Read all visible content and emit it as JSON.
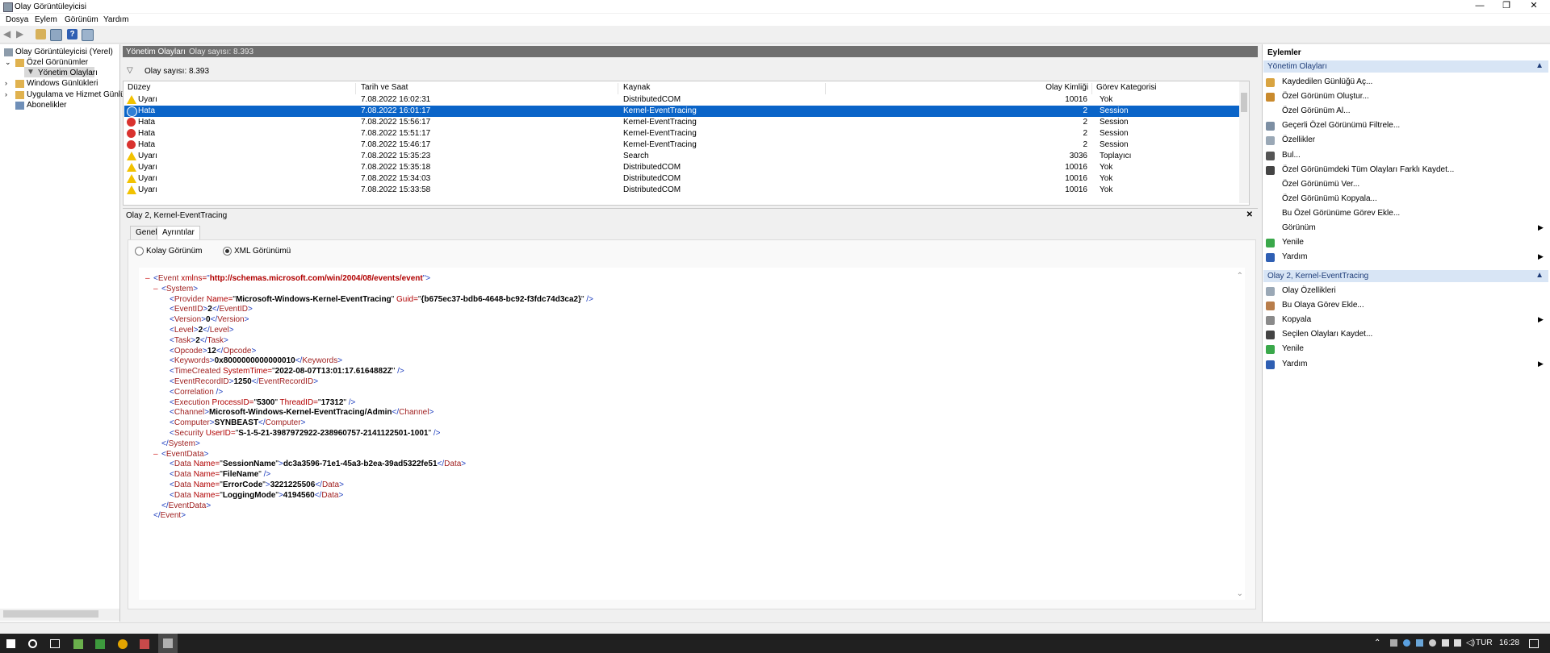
{
  "window": {
    "title": "Olay Görüntüleyicisi",
    "minimize": "—",
    "maximize": "❐",
    "close": "✕"
  },
  "menu": [
    "Dosya",
    "Eylem",
    "Görünüm",
    "Yardım"
  ],
  "tree": {
    "root": "Olay Görüntüleyicisi (Yerel)",
    "custom_views": "Özel Görünümler",
    "admin_events": "Yönetim Olayları",
    "windows_logs": "Windows Günlükleri",
    "app_service_logs": "Uygulama ve Hizmet Günlük",
    "subscriptions": "Abonelikler"
  },
  "center": {
    "header_title": "Yönetim Olayları",
    "header_count": "Olay sayısı: 8.393",
    "filter_count": "Olay sayısı: 8.393",
    "columns": [
      "Düzey",
      "Tarih ve Saat",
      "Kaynak",
      "Olay Kimliği",
      "Görev Kategorisi"
    ],
    "rows": [
      {
        "level": "Uyarı",
        "icon": "warning-icon",
        "date": "7.08.2022 16:02:31",
        "source": "DistributedCOM",
        "id": "10016",
        "category": "Yok",
        "selected": false
      },
      {
        "level": "Hata",
        "icon": "info-icon",
        "date": "7.08.2022 16:01:17",
        "source": "Kernel-EventTracing",
        "id": "2",
        "category": "Session",
        "selected": true
      },
      {
        "level": "Hata",
        "icon": "error-icon",
        "date": "7.08.2022 15:56:17",
        "source": "Kernel-EventTracing",
        "id": "2",
        "category": "Session",
        "selected": false
      },
      {
        "level": "Hata",
        "icon": "error-icon",
        "date": "7.08.2022 15:51:17",
        "source": "Kernel-EventTracing",
        "id": "2",
        "category": "Session",
        "selected": false
      },
      {
        "level": "Hata",
        "icon": "error-icon",
        "date": "7.08.2022 15:46:17",
        "source": "Kernel-EventTracing",
        "id": "2",
        "category": "Session",
        "selected": false
      },
      {
        "level": "Uyarı",
        "icon": "warning-icon",
        "date": "7.08.2022 15:35:23",
        "source": "Search",
        "id": "3036",
        "category": "Toplayıcı",
        "selected": false
      },
      {
        "level": "Uyarı",
        "icon": "warning-icon",
        "date": "7.08.2022 15:35:18",
        "source": "DistributedCOM",
        "id": "10016",
        "category": "Yok",
        "selected": false
      },
      {
        "level": "Uyarı",
        "icon": "warning-icon",
        "date": "7.08.2022 15:34:03",
        "source": "DistributedCOM",
        "id": "10016",
        "category": "Yok",
        "selected": false
      },
      {
        "level": "Uyarı",
        "icon": "warning-icon",
        "date": "7.08.2022 15:33:58",
        "source": "DistributedCOM",
        "id": "10016",
        "category": "Yok",
        "selected": false
      }
    ]
  },
  "detail": {
    "title": "Olay 2, Kernel-EventTracing",
    "close": "✕",
    "tabs": [
      "Genel",
      "Ayrıntılar"
    ],
    "active_tab": "Ayrıntılar",
    "radio_friendly": "Kolay Görünüm",
    "radio_xml": "XML Görünümü",
    "xml_selected": true,
    "xml_lines": [
      {
        "indent": 0,
        "marker": "–",
        "html": "<span class='brk'>&lt;</span><span class='tag'>Event</span> <span class='attr'>xmlns=</span><span class='brk'>\"</span><span class='attr'><b>http://schemas.microsoft.com/win/2004/08/events/event</b></span><span class='brk'>\"&gt;</span>"
      },
      {
        "indent": 1,
        "marker": "–",
        "html": "<span class='brk'>&lt;</span><span class='tag'>System</span><span class='brk'>&gt;</span>"
      },
      {
        "indent": 2,
        "html": "<span class='brk'>&lt;</span><span class='tag'>Provider</span> <span class='attr'>Name=</span>\"<span class='val'>Microsoft-Windows-Kernel-EventTracing</span>\" <span class='attr'>Guid=</span>\"<span class='val'>{b675ec37-bdb6-4648-bc92-f3fdc74d3ca2}</span>\" <span class='brk'>/&gt;</span>"
      },
      {
        "indent": 2,
        "html": "<span class='brk'>&lt;</span><span class='tag'>EventID</span><span class='brk'>&gt;</span><span class='val'>2</span><span class='brk'>&lt;/</span><span class='tag'>EventID</span><span class='brk'>&gt;</span>"
      },
      {
        "indent": 2,
        "html": "<span class='brk'>&lt;</span><span class='tag'>Version</span><span class='brk'>&gt;</span><span class='val'>0</span><span class='brk'>&lt;/</span><span class='tag'>Version</span><span class='brk'>&gt;</span>"
      },
      {
        "indent": 2,
        "html": "<span class='brk'>&lt;</span><span class='tag'>Level</span><span class='brk'>&gt;</span><span class='val'>2</span><span class='brk'>&lt;/</span><span class='tag'>Level</span><span class='brk'>&gt;</span>"
      },
      {
        "indent": 2,
        "html": "<span class='brk'>&lt;</span><span class='tag'>Task</span><span class='brk'>&gt;</span><span class='val'>2</span><span class='brk'>&lt;/</span><span class='tag'>Task</span><span class='brk'>&gt;</span>"
      },
      {
        "indent": 2,
        "html": "<span class='brk'>&lt;</span><span class='tag'>Opcode</span><span class='brk'>&gt;</span><span class='val'>12</span><span class='brk'>&lt;/</span><span class='tag'>Opcode</span><span class='brk'>&gt;</span>"
      },
      {
        "indent": 2,
        "html": "<span class='brk'>&lt;</span><span class='tag'>Keywords</span><span class='brk'>&gt;</span><span class='val'>0x8000000000000010</span><span class='brk'>&lt;/</span><span class='tag'>Keywords</span><span class='brk'>&gt;</span>"
      },
      {
        "indent": 2,
        "html": "<span class='brk'>&lt;</span><span class='tag'>TimeCreated</span> <span class='attr'>SystemTime=</span>\"<span class='val'>2022-08-07T13:01:17.6164882Z</span>\" <span class='brk'>/&gt;</span>"
      },
      {
        "indent": 2,
        "html": "<span class='brk'>&lt;</span><span class='tag'>EventRecordID</span><span class='brk'>&gt;</span><span class='val'>1250</span><span class='brk'>&lt;/</span><span class='tag'>EventRecordID</span><span class='brk'>&gt;</span>"
      },
      {
        "indent": 2,
        "html": "<span class='brk'>&lt;</span><span class='tag'>Correlation</span> <span class='brk'>/&gt;</span>"
      },
      {
        "indent": 2,
        "html": "<span class='brk'>&lt;</span><span class='tag'>Execution</span> <span class='attr'>ProcessID=</span>\"<span class='val'>5300</span>\" <span class='attr'>ThreadID=</span>\"<span class='val'>17312</span>\" <span class='brk'>/&gt;</span>"
      },
      {
        "indent": 2,
        "html": "<span class='brk'>&lt;</span><span class='tag'>Channel</span><span class='brk'>&gt;</span><span class='val'>Microsoft-Windows-Kernel-EventTracing/Admin</span><span class='brk'>&lt;/</span><span class='tag'>Channel</span><span class='brk'>&gt;</span>"
      },
      {
        "indent": 2,
        "html": "<span class='brk'>&lt;</span><span class='tag'>Computer</span><span class='brk'>&gt;</span><span class='val'>SYNBEAST</span><span class='brk'>&lt;/</span><span class='tag'>Computer</span><span class='brk'>&gt;</span>"
      },
      {
        "indent": 2,
        "html": "<span class='brk'>&lt;</span><span class='tag'>Security</span> <span class='attr'>UserID=</span>\"<span class='val'>S-1-5-21-3987972922-238960757-2141122501-1001</span>\" <span class='brk'>/&gt;</span>"
      },
      {
        "indent": 1,
        "html": "<span class='brk'>&lt;/</span><span class='tag'>System</span><span class='brk'>&gt;</span>"
      },
      {
        "indent": 1,
        "marker": "–",
        "html": "<span class='brk'>&lt;</span><span class='tag'>EventData</span><span class='brk'>&gt;</span>"
      },
      {
        "indent": 2,
        "html": "<span class='brk'>&lt;</span><span class='tag'>Data</span> <span class='attr'>Name=</span>\"<span class='val'>SessionName</span>\"<span class='brk'>&gt;</span><span class='val'>dc3a3596-71e1-45a3-b2ea-39ad5322fe51</span><span class='brk'>&lt;/</span><span class='tag'>Data</span><span class='brk'>&gt;</span>"
      },
      {
        "indent": 2,
        "html": "<span class='brk'>&lt;</span><span class='tag'>Data</span> <span class='attr'>Name=</span>\"<span class='val'>FileName</span>\" <span class='brk'>/&gt;</span>"
      },
      {
        "indent": 2,
        "html": "<span class='brk'>&lt;</span><span class='tag'>Data</span> <span class='attr'>Name=</span>\"<span class='val'>ErrorCode</span>\"<span class='brk'>&gt;</span><span class='val'>3221225506</span><span class='brk'>&lt;/</span><span class='tag'>Data</span><span class='brk'>&gt;</span>"
      },
      {
        "indent": 2,
        "html": "<span class='brk'>&lt;</span><span class='tag'>Data</span> <span class='attr'>Name=</span>\"<span class='val'>LoggingMode</span>\"<span class='brk'>&gt;</span><span class='val'>4194560</span><span class='brk'>&lt;/</span><span class='tag'>Data</span><span class='brk'>&gt;</span>"
      },
      {
        "indent": 1,
        "html": "<span class='brk'>&lt;/</span><span class='tag'>EventData</span><span class='brk'>&gt;</span>"
      },
      {
        "indent": 0,
        "html": "<span class='brk'>&lt;/</span><span class='tag'>Event</span><span class='brk'>&gt;</span>"
      }
    ]
  },
  "actions": {
    "title": "Eylemler",
    "section1": "Yönetim Olayları",
    "items1": [
      {
        "label": "Kaydedilen Günlüğü Aç...",
        "icon": "folder-open-icon",
        "arrow": false
      },
      {
        "label": "Özel Görünüm Oluştur...",
        "icon": "filter-create-icon",
        "arrow": false
      },
      {
        "label": "Özel Görünüm Al...",
        "icon": "",
        "arrow": false
      },
      {
        "label": "Geçerli Özel Görünümü Filtrele...",
        "icon": "filter-icon",
        "arrow": false
      },
      {
        "label": "Özellikler",
        "icon": "properties-icon",
        "arrow": false
      },
      {
        "label": "Bul...",
        "icon": "find-icon",
        "arrow": false
      },
      {
        "label": "Özel Görünümdeki Tüm Olayları Farklı Kaydet...",
        "icon": "save-icon",
        "arrow": false
      },
      {
        "label": "Özel Görünümü Ver...",
        "icon": "",
        "arrow": false
      },
      {
        "label": "Özel Görünümü Kopyala...",
        "icon": "",
        "arrow": false
      },
      {
        "label": "Bu Özel Görünüme Görev Ekle...",
        "icon": "",
        "arrow": false
      },
      {
        "label": "Görünüm",
        "icon": "",
        "arrow": true
      },
      {
        "label": "Yenile",
        "icon": "refresh-icon",
        "arrow": false
      },
      {
        "label": "Yardım",
        "icon": "help-icon",
        "arrow": true
      }
    ],
    "section2": "Olay 2, Kernel-EventTracing",
    "items2": [
      {
        "label": "Olay Özellikleri",
        "icon": "event-properties-icon",
        "arrow": false
      },
      {
        "label": "Bu Olaya Görev Ekle...",
        "icon": "task-icon",
        "arrow": false
      },
      {
        "label": "Kopyala",
        "icon": "copy-icon",
        "arrow": true
      },
      {
        "label": "Seçilen Olayları Kaydet...",
        "icon": "save-icon",
        "arrow": false
      },
      {
        "label": "Yenile",
        "icon": "refresh-icon",
        "arrow": false
      },
      {
        "label": "Yardım",
        "icon": "help-icon",
        "arrow": true
      }
    ]
  },
  "taskbar": {
    "lang": "TUR",
    "time": "16:28"
  }
}
